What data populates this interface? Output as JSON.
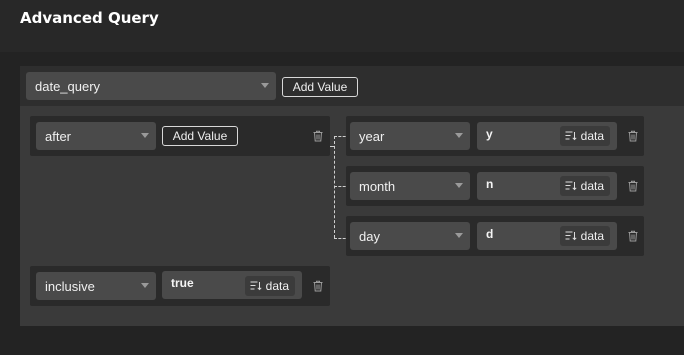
{
  "title": "Advanced Query",
  "root": {
    "field": "date_query",
    "add_value_label": "Add Value"
  },
  "after": {
    "field": "after",
    "add_value_label": "Add Value",
    "children": [
      {
        "field": "year",
        "value": "y",
        "source_label": "data"
      },
      {
        "field": "month",
        "value": "n",
        "source_label": "data"
      },
      {
        "field": "day",
        "value": "d",
        "source_label": "data"
      }
    ]
  },
  "inclusive": {
    "field": "inclusive",
    "value": "true",
    "source_label": "data"
  },
  "icons": {
    "trash": "trash-icon",
    "source": "sort-data-icon",
    "caret": "chevron-down-icon"
  }
}
